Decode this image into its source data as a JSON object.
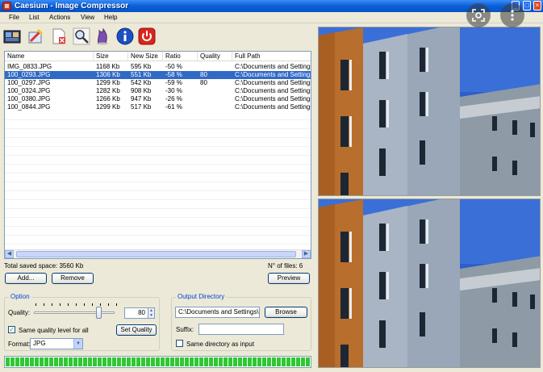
{
  "window": {
    "title": "Caesium - Image Compressor",
    "buttons": [
      "_",
      "□",
      "×"
    ]
  },
  "menu": [
    "File",
    "List",
    "Actions",
    "View",
    "Help"
  ],
  "toolbar": [
    {
      "icon": "open-images-icon"
    },
    {
      "icon": "clear-list-icon"
    },
    {
      "icon": "remove-item-icon"
    },
    {
      "icon": "preview-magnifier-icon"
    },
    {
      "icon": "compress-icon"
    },
    {
      "icon": "info-icon"
    },
    {
      "icon": "exit-icon"
    }
  ],
  "files": {
    "columns": [
      "Name",
      "Size",
      "New Size",
      "Ratio",
      "Quality",
      "Full Path"
    ],
    "rows": [
      {
        "name": "IMG_0833.JPG",
        "size": "1168 Kb",
        "new_size": "595 Kb",
        "ratio": "-50 %",
        "quality": "",
        "path": "C:\\Documents and Settings",
        "selected": false
      },
      {
        "name": "100_0293.JPG",
        "size": "1306 Kb",
        "new_size": "551 Kb",
        "ratio": "-58 %",
        "quality": "80",
        "path": "C:\\Documents and Settings",
        "selected": true
      },
      {
        "name": "100_0297.JPG",
        "size": "1299 Kb",
        "new_size": "542 Kb",
        "ratio": "-59 %",
        "quality": "80",
        "path": "C:\\Documents and Settings",
        "selected": false
      },
      {
        "name": "100_0324.JPG",
        "size": "1282 Kb",
        "new_size": "908 Kb",
        "ratio": "-30 %",
        "quality": "",
        "path": "C:\\Documents and Settings",
        "selected": false
      },
      {
        "name": "100_0380.JPG",
        "size": "1266 Kb",
        "new_size": "947 Kb",
        "ratio": "-26 %",
        "quality": "",
        "path": "C:\\Documents and Settings",
        "selected": false
      },
      {
        "name": "100_0844.JPG",
        "size": "1299 Kb",
        "new_size": "517 Kb",
        "ratio": "-61 %",
        "quality": "",
        "path": "C:\\Documents and Settings",
        "selected": false
      }
    ]
  },
  "status": {
    "saved": "Total saved space: 3560 Kb",
    "count": "N° of files: 6"
  },
  "buttons": {
    "add": "Add...",
    "remove": "Remove",
    "preview": "Preview",
    "set_quality": "Set Quality",
    "browse": "Browse"
  },
  "option": {
    "title": "Option",
    "quality_label": "Quality:",
    "quality_value": "80",
    "quality_slider": 0.8,
    "same_quality_label": "Same quality level for all",
    "same_quality_checked": true,
    "format_label": "Format:",
    "format_value": "JPG"
  },
  "output": {
    "title": "Output Directory",
    "directory": "C:\\Documents and Settings\\",
    "suffix_label": "Suffix:",
    "suffix_value": "",
    "same_dir_label": "Same directory as input",
    "same_dir_checked": false
  },
  "progress": {
    "percent": 100,
    "color": "#30c830"
  },
  "overlay": [
    {
      "icon": "lens-search-icon"
    },
    {
      "icon": "more-vertical-icon"
    }
  ],
  "colors": {
    "title_bar": "#0a5fd8",
    "selection": "#316ac5",
    "group_title": "#0046d5"
  }
}
